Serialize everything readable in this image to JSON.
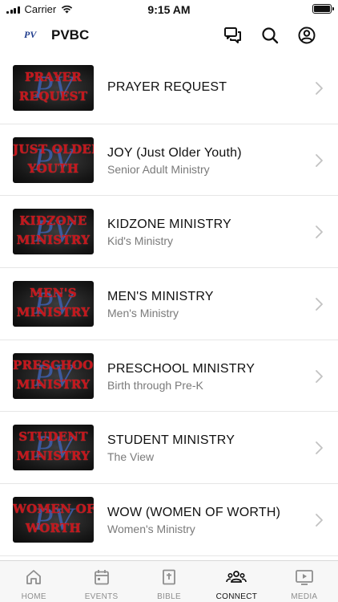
{
  "status": {
    "carrier": "Carrier",
    "time": "9:15 AM"
  },
  "header": {
    "logo": "PV",
    "title": "PVBC"
  },
  "items": [
    {
      "thumb_line1": "PRAYER",
      "thumb_line2": "REQUEST",
      "title": "PRAYER REQUEST",
      "subtitle": ""
    },
    {
      "thumb_line1": "JUST OLDER",
      "thumb_line2": "YOUTH",
      "title": "JOY (Just Older Youth)",
      "subtitle": "Senior Adult Ministry"
    },
    {
      "thumb_line1": "KIDZONE",
      "thumb_line2": "MINISTRY",
      "title": "KIDZONE MINISTRY",
      "subtitle": "Kid's Ministry"
    },
    {
      "thumb_line1": "MEN'S",
      "thumb_line2": "MINISTRY",
      "title": "MEN'S MINISTRY",
      "subtitle": "Men's Ministry"
    },
    {
      "thumb_line1": "PRESCHOOL",
      "thumb_line2": "MINISTRY",
      "title": "PRESCHOOL MINISTRY",
      "subtitle": "Birth through Pre-K"
    },
    {
      "thumb_line1": "STUDENT",
      "thumb_line2": "MINISTRY",
      "title": "STUDENT MINISTRY",
      "subtitle": "The View"
    },
    {
      "thumb_line1": "WOMEN OF",
      "thumb_line2": "WORTH",
      "title": "WOW (WOMEN OF WORTH)",
      "subtitle": "Women's Ministry"
    }
  ],
  "tabs": [
    {
      "label": "HOME",
      "icon": "home-icon",
      "active": false
    },
    {
      "label": "EVENTS",
      "icon": "calendar-icon",
      "active": false
    },
    {
      "label": "BIBLE",
      "icon": "bible-icon",
      "active": false
    },
    {
      "label": "CONNECT",
      "icon": "people-icon",
      "active": true
    },
    {
      "label": "MEDIA",
      "icon": "play-icon",
      "active": false
    }
  ],
  "colors": {
    "thumb_text": "#c4161c",
    "thumb_logo": "#3f63b8",
    "subtitle": "#7a7a7a",
    "inactive_tab": "#8e8e8e"
  }
}
